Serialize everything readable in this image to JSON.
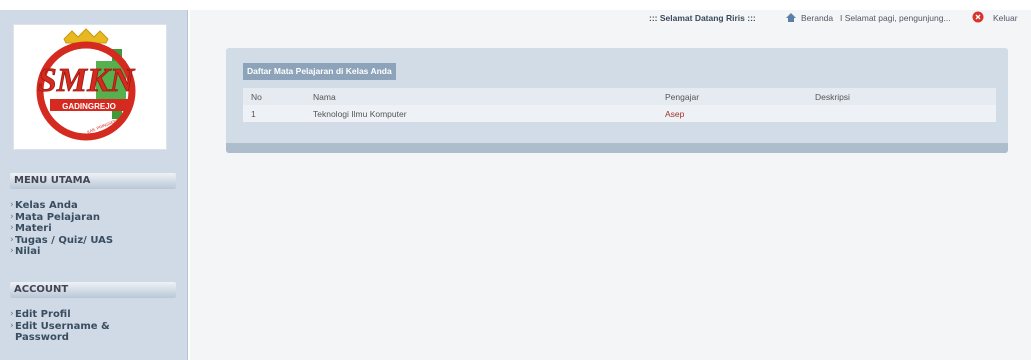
{
  "topbar": {
    "greeting": "::: Selamat Datang Riris :::",
    "home_label": "Beranda",
    "message": "I Selamat pagi, pengunjung...",
    "logout_label": "Keluar"
  },
  "logo": {
    "text": "SMKN",
    "banner": "GADINGREJO",
    "subtext": "KAB. PRINGSEWU"
  },
  "sidebar": {
    "menu_title": "MENU UTAMA",
    "menu_items": [
      "Kelas Anda",
      "Mata Pelajaran",
      "Materi",
      "Tugas / Quiz/ UAS",
      "Nilai"
    ],
    "account_title": "ACCOUNT",
    "account_items": [
      "Edit Profil",
      "Edit Username & Password"
    ]
  },
  "main": {
    "title": "Daftar Mata Pelajaran di Kelas Anda",
    "columns": [
      "No",
      "Nama",
      "Pengajar",
      "Deskripsi"
    ],
    "rows": [
      {
        "no": "1",
        "nama": "Teknologi Ilmu Komputer",
        "pengajar": "Asep",
        "deskripsi": ""
      }
    ]
  },
  "colors": {
    "sidebar_bg": "#cfdae6",
    "panel_bg": "#d2dce6",
    "title_bg": "#8da3b9",
    "link_red": "#a0322a",
    "logo_red": "#d42a1f",
    "logo_gold": "#e8b820",
    "logo_green": "#3f9b3a"
  }
}
